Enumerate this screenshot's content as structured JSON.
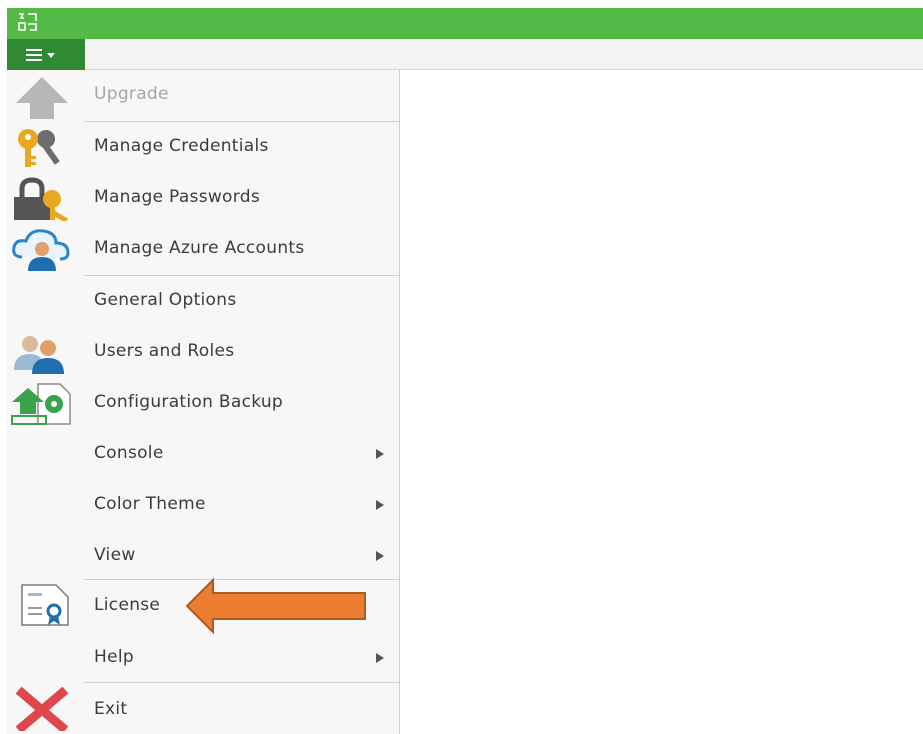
{
  "window": {
    "title_color": "#55b948",
    "menu_button_color": "#2f8a33",
    "logo_icon": "app-logo-icon",
    "menu_button_icon": "hamburger-icon"
  },
  "menu": {
    "items": [
      {
        "label": "Upgrade",
        "icon": "upgrade-arrow-icon",
        "enabled": false
      },
      {
        "label": "Manage Credentials",
        "icon": "keys-icon"
      },
      {
        "label": "Manage Passwords",
        "icon": "lock-key-icon"
      },
      {
        "label": "Manage Azure Accounts",
        "icon": "cloud-user-icon"
      },
      {
        "label": "General Options"
      },
      {
        "label": "Users and Roles",
        "icon": "users-icon"
      },
      {
        "label": "Configuration Backup",
        "icon": "config-backup-icon"
      },
      {
        "label": "Console",
        "submenu": true
      },
      {
        "label": "Color Theme",
        "submenu": true
      },
      {
        "label": "View",
        "submenu": true
      },
      {
        "label": "License",
        "icon": "license-icon"
      },
      {
        "label": "Help",
        "submenu": true
      },
      {
        "label": "Exit",
        "icon": "exit-x-icon"
      }
    ]
  },
  "annotation": {
    "arrow_color": "#ed7d31",
    "points_to": "License"
  }
}
